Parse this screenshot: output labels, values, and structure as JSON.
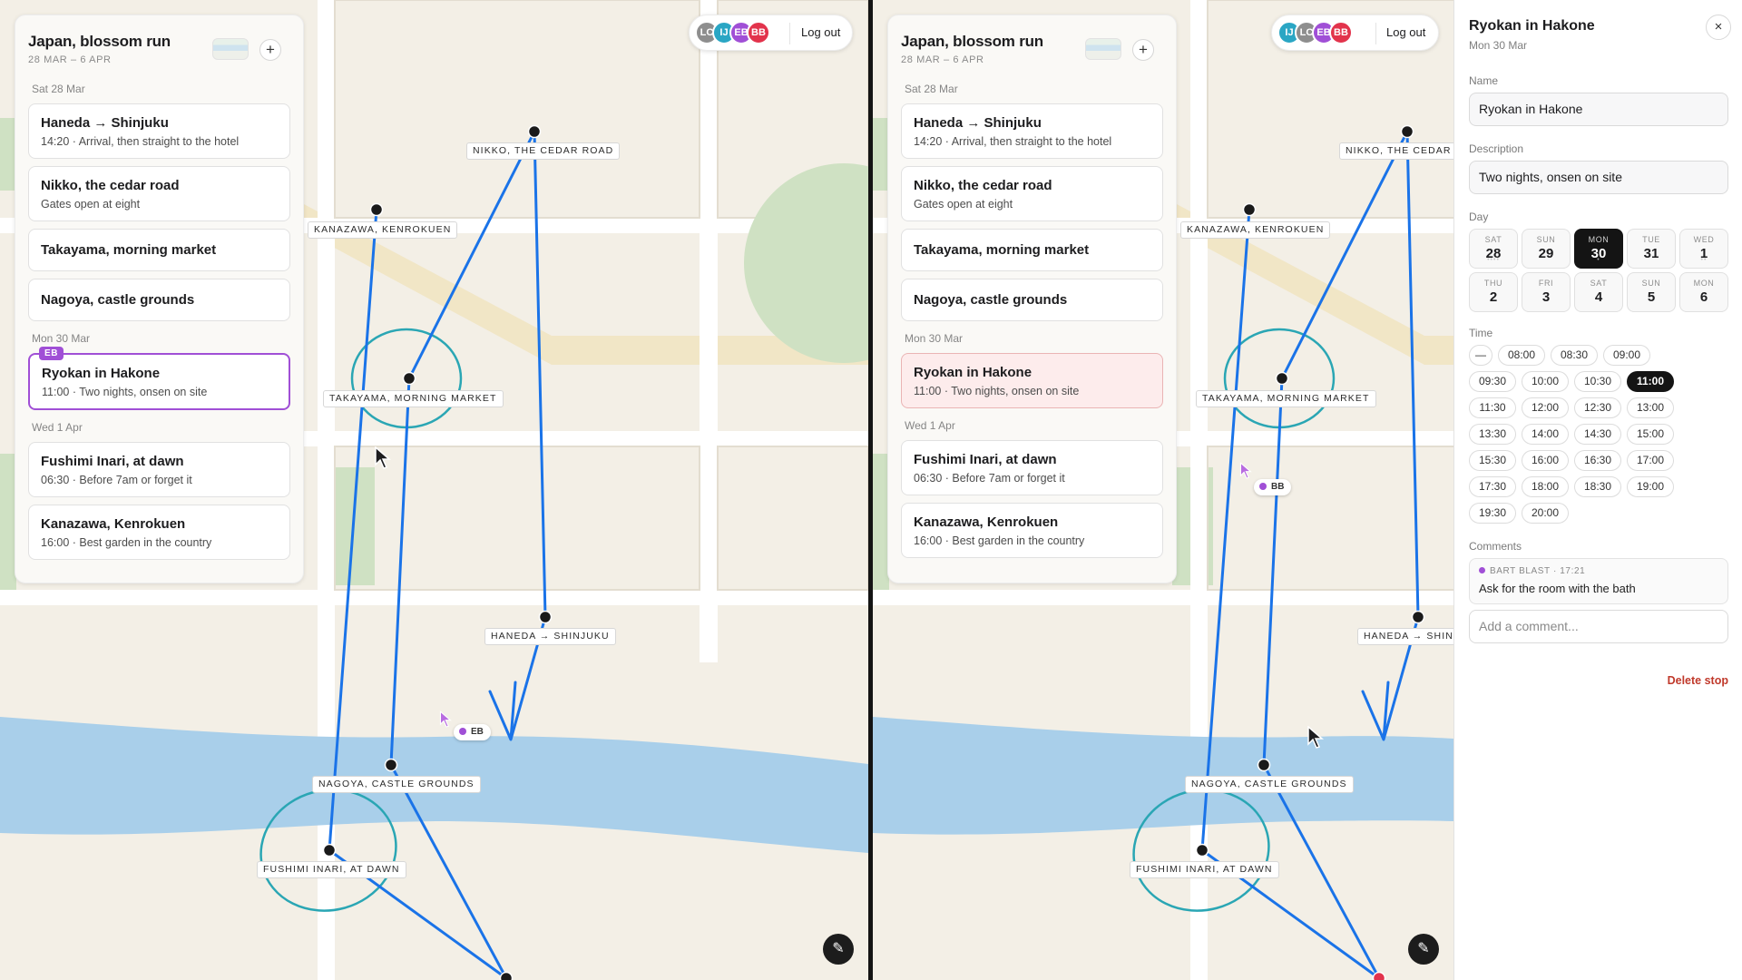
{
  "trip": {
    "title": "Japan, blossom run",
    "dates": "28 MAR – 6 APR",
    "add_label": "+"
  },
  "days": [
    {
      "label": "Sat 28 Mar",
      "stops": [
        {
          "title": "Haneda → Shinjuku",
          "sub": "14:20 · Arrival, then straight to the hotel"
        },
        {
          "title": "Nikko, the cedar road",
          "sub": "Gates open at eight"
        },
        {
          "title": "Takayama, morning market",
          "sub": ""
        },
        {
          "title": "Nagoya, castle grounds",
          "sub": ""
        }
      ]
    },
    {
      "label": "Mon 30 Mar",
      "stops": [
        {
          "title": "Ryokan in Hakone",
          "sub": "11:00 · Two nights, onsen on site",
          "editor_badge": "EB"
        }
      ]
    },
    {
      "label": "Wed 1 Apr",
      "stops": [
        {
          "title": "Fushimi Inari, at dawn",
          "sub": "06:30 · Before 7am or forget it"
        },
        {
          "title": "Kanazawa, Kenrokuen",
          "sub": "16:00 · Best garden in the country"
        }
      ]
    }
  ],
  "presence_left": [
    {
      "initials": "LC",
      "color": "#8e8e8e"
    },
    {
      "initials": "IJ",
      "color": "#2aa6c4"
    },
    {
      "initials": "EB",
      "color": "#a04fd6"
    },
    {
      "initials": "BB",
      "color": "#e2334c"
    }
  ],
  "presence_right": [
    {
      "initials": "IJ",
      "color": "#2aa6c4"
    },
    {
      "initials": "LC",
      "color": "#8e8e8e"
    },
    {
      "initials": "EB",
      "color": "#a04fd6"
    },
    {
      "initials": "BB",
      "color": "#e2334c"
    }
  ],
  "logout_label": "Log out",
  "map_labels": {
    "nikko": "NIKKO, THE CEDAR ROAD",
    "kanazawa": "KANAZAWA, KENROKUEN",
    "takayama": "TAKAYAMA, MORNING MARKET",
    "haneda": "HANEDA → SHINJUKU",
    "haneda_clipped": "HANEDA → SHIN…",
    "nagoya": "NAGOYA, CASTLE GROUNDS",
    "fushimi": "FUSHIMI INARI, AT DAWN",
    "nikko_clipped": "NIKKO, THE CEDAR ROA"
  },
  "cursors": {
    "left_tag": "EB",
    "left_tag_color": "#a04fd6",
    "right_tag": "BB",
    "right_tag_color": "#a04fd6"
  },
  "colors": {
    "route": "#1a73e8",
    "circle": "#2aa6b4",
    "water": "#a9cfea",
    "park": "#cfe1c3",
    "road_major": "#f1e6c6",
    "selected_stop_border": "#a04fd6",
    "selected_stop_bg": "#fdecec",
    "highlight_pin": "#e2334c"
  },
  "panel": {
    "title": "Ryokan in Hakone",
    "date": "Mon 30 Mar",
    "close_icon": "×",
    "name_label": "Name",
    "name_value": "Ryokan in Hakone",
    "description_label": "Description",
    "description_value": "Two nights, onsen on site",
    "day_label": "Day",
    "days": [
      {
        "dow": "SAT",
        "num": "28",
        "dots": "••••",
        "selected": false
      },
      {
        "dow": "SUN",
        "num": "29",
        "dots": "",
        "selected": false
      },
      {
        "dow": "MON",
        "num": "30",
        "dots": "•",
        "selected": true
      },
      {
        "dow": "TUE",
        "num": "31",
        "dots": "",
        "selected": false
      },
      {
        "dow": "WED",
        "num": "1",
        "dots": "••",
        "selected": false
      },
      {
        "dow": "THU",
        "num": "2",
        "dots": "",
        "selected": false
      },
      {
        "dow": "FRI",
        "num": "3",
        "dots": "",
        "selected": false
      },
      {
        "dow": "SAT",
        "num": "4",
        "dots": "",
        "selected": false
      },
      {
        "dow": "SUN",
        "num": "5",
        "dots": "",
        "selected": false
      },
      {
        "dow": "MON",
        "num": "6",
        "dots": "",
        "selected": false
      }
    ],
    "time_label": "Time",
    "times": [
      "—",
      "08:00",
      "08:30",
      "09:00",
      "09:30",
      "10:00",
      "10:30",
      "11:00",
      "11:30",
      "12:00",
      "12:30",
      "13:00",
      "13:30",
      "14:00",
      "14:30",
      "15:00",
      "15:30",
      "16:00",
      "16:30",
      "17:00",
      "17:30",
      "18:00",
      "18:30",
      "19:00",
      "19:30",
      "20:00"
    ],
    "selected_time": "11:00",
    "comments_label": "Comments",
    "comment_author": "BART BLAST · 17:21",
    "comment_text": "Ask for the room with the bath",
    "comment_placeholder": "Add a comment...",
    "delete_label": "Delete stop"
  }
}
